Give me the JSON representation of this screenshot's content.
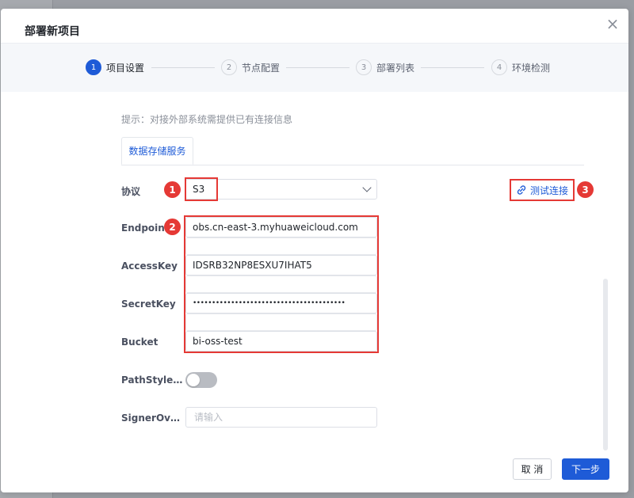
{
  "dialog": {
    "title": "部署新项目",
    "close_label": "×"
  },
  "steps": [
    {
      "num": "1",
      "label": "项目设置",
      "active": true
    },
    {
      "num": "2",
      "label": "节点配置",
      "active": false
    },
    {
      "num": "3",
      "label": "部署列表",
      "active": false
    },
    {
      "num": "4",
      "label": "环境检测",
      "active": false
    }
  ],
  "hint": "提示：对接外部系统需提供已有连接信息",
  "tab": {
    "label": "数据存储服务"
  },
  "form": {
    "protocol": {
      "label": "协议",
      "value": "S3"
    },
    "endpoint": {
      "label": "Endpoint",
      "value": "obs.cn-east-3.myhuaweicloud.com"
    },
    "access_key": {
      "label": "AccessKey",
      "value": "IDSRB32NP8ESXU7IHAT5"
    },
    "secret_key": {
      "label": "SecretKey",
      "value": "••••••••••••••••••••••••••••••••••••••••"
    },
    "bucket": {
      "label": "Bucket",
      "value": "bi-oss-test"
    },
    "path_style": {
      "label": "PathStyleAcc...",
      "checked": false
    },
    "signer_override": {
      "label": "SignerOverri...",
      "placeholder": "请输入"
    }
  },
  "test_connection": {
    "label": "测试连接"
  },
  "markers": [
    "1",
    "2",
    "3"
  ],
  "buttons": {
    "cancel": "取 消",
    "next": "下一步"
  },
  "colors": {
    "accent": "#1e5bd7",
    "annotation": "#e53935"
  }
}
